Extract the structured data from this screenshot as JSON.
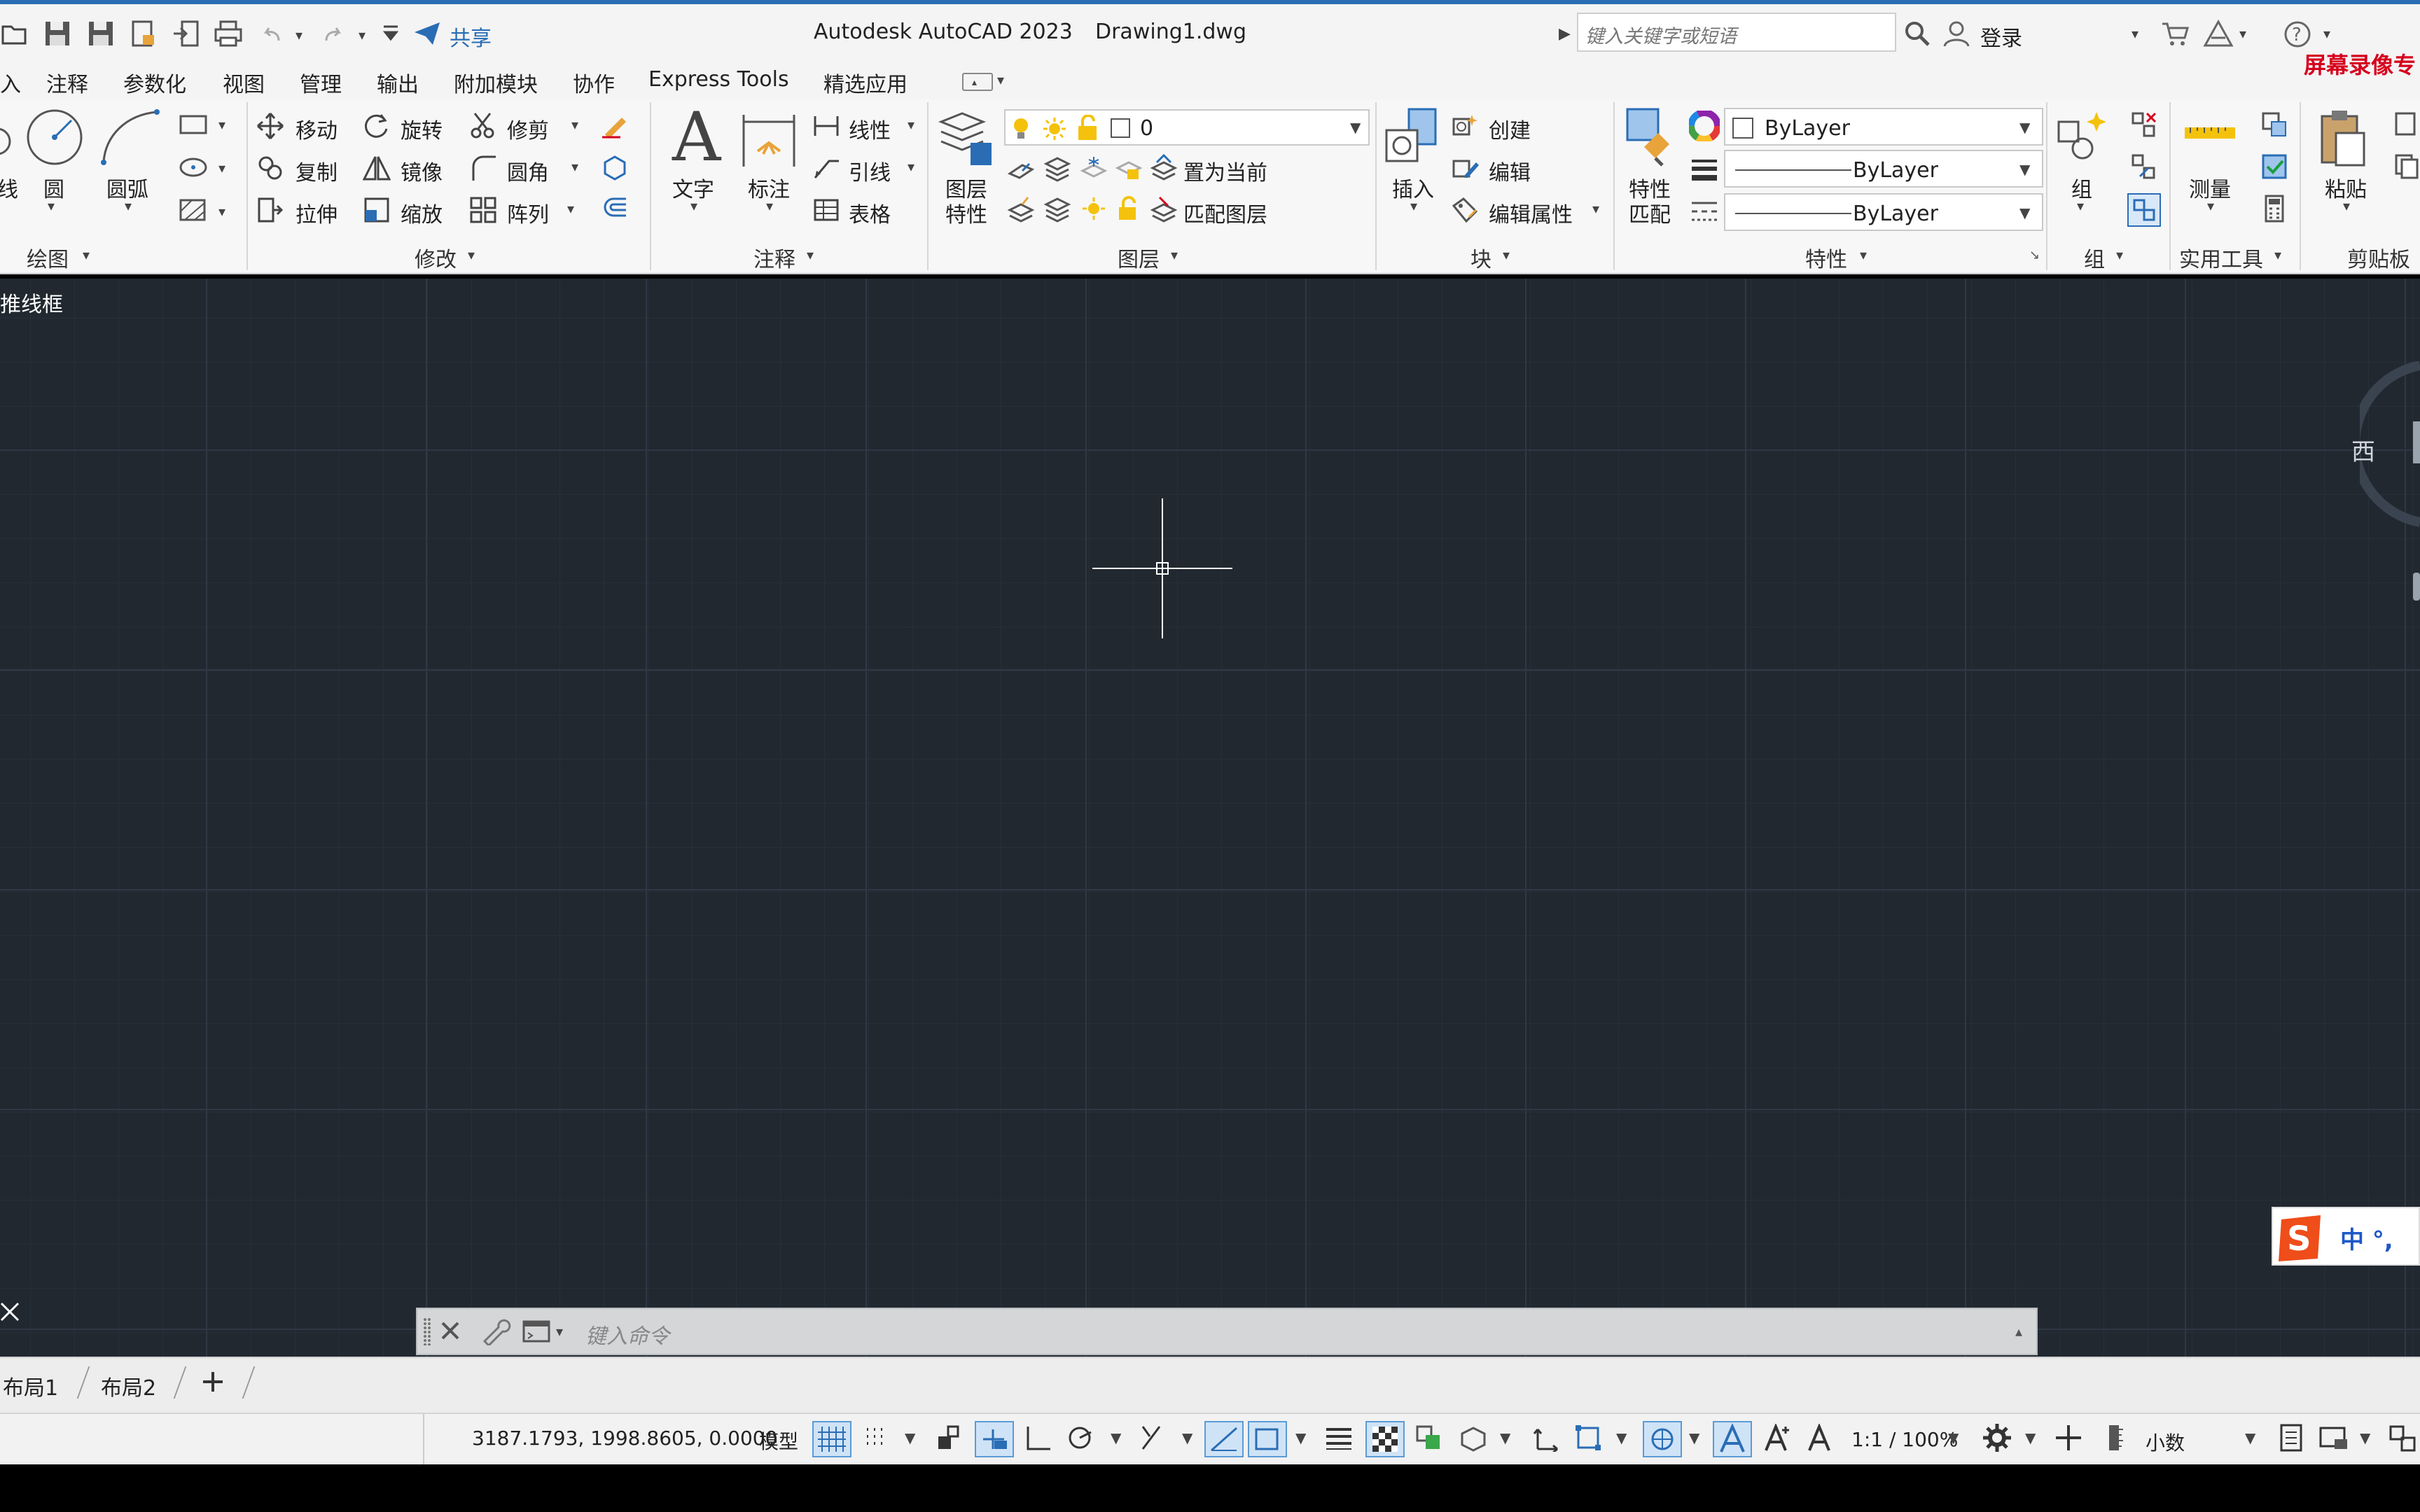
{
  "titlebar": {
    "share_label": "共享",
    "app_title": "Autodesk AutoCAD 2023",
    "file_name": "Drawing1.dwg",
    "search_placeholder": "键入关键字或短语",
    "login_label": "登录",
    "watermark": "屏幕录像专"
  },
  "menu_tabs": [
    "入",
    "注释",
    "参数化",
    "视图",
    "管理",
    "输出",
    "附加模块",
    "协作",
    "Express Tools",
    "精选应用"
  ],
  "ribbon": {
    "draw": {
      "line_partial": "线",
      "circle": "圆",
      "arc": "圆弧",
      "panel": "绘图"
    },
    "modify": {
      "move": "移动",
      "rotate": "旋转",
      "trim": "修剪",
      "copy": "复制",
      "mirror": "镜像",
      "fillet": "圆角",
      "stretch": "拉伸",
      "scale": "缩放",
      "array": "阵列",
      "panel": "修改"
    },
    "annotation": {
      "text": "文字",
      "dimension": "标注",
      "linear": "线性",
      "leader": "引线",
      "table": "表格",
      "panel": "注释"
    },
    "layers": {
      "layer_properties_1": "图层",
      "layer_properties_2": "特性",
      "current_layer": "0",
      "set_current": "置为当前",
      "match_layer": "匹配图层",
      "panel": "图层"
    },
    "block": {
      "insert": "插入",
      "create": "创建",
      "edit": "编辑",
      "edit_attributes": "编辑属性",
      "panel": "块"
    },
    "properties": {
      "match_1": "特性",
      "match_2": "匹配",
      "color": "ByLayer",
      "lineweight": "ByLayer",
      "linetype": "ByLayer",
      "panel": "特性"
    },
    "groups": {
      "group": "组",
      "panel": "组"
    },
    "utilities": {
      "measure": "测量",
      "panel": "实用工具"
    },
    "clipboard": {
      "paste": "粘贴",
      "panel": "剪贴板"
    }
  },
  "canvas": {
    "viewport_label": "推线框",
    "viewcube_west": "西",
    "ime_label": "中 °,"
  },
  "command": {
    "placeholder": "键入命令"
  },
  "layouts": [
    "布局1",
    "布局2"
  ],
  "status": {
    "coordinates": "3187.1793, 1998.8605, 0.0000",
    "model": "模型",
    "scale": "1:1 / 100%",
    "units": "小数"
  },
  "colors": {
    "canvas": "#212830",
    "grid_major": "#2f3844",
    "accent_blue": "#2a6db5",
    "watermark_red": "#d6001c"
  }
}
